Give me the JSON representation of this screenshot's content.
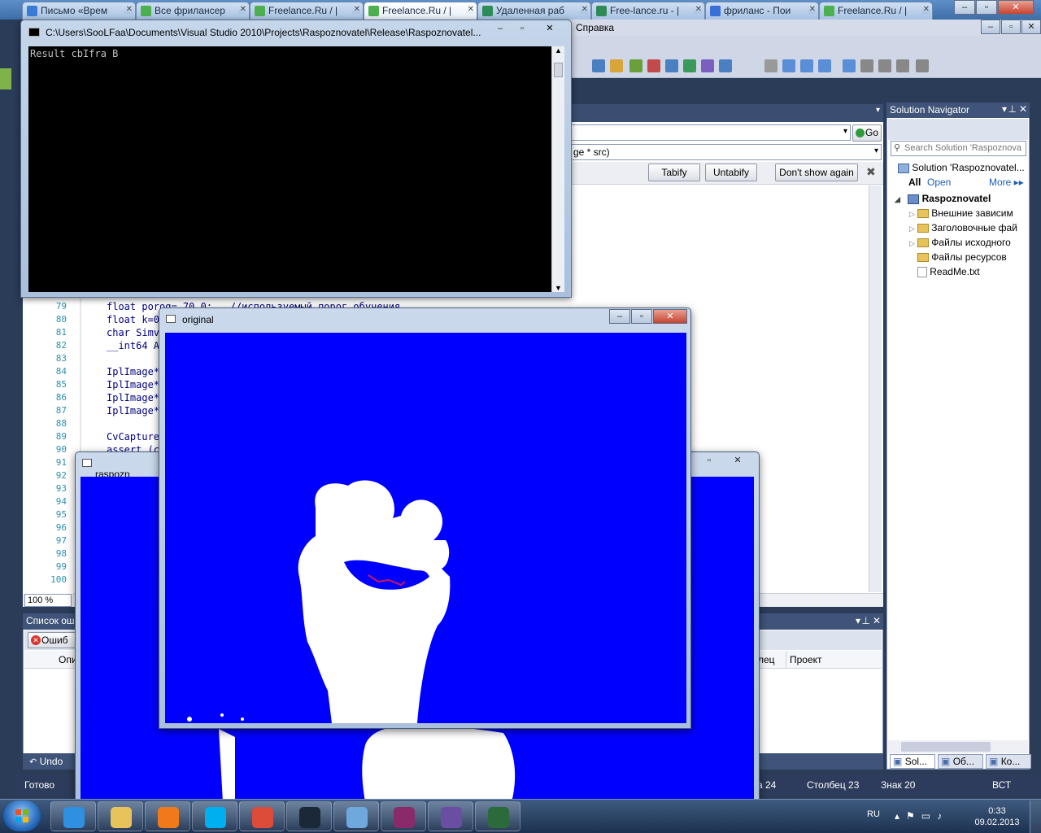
{
  "browser": {
    "tabs": [
      {
        "label": "Письмо «Врем",
        "color": "#3a7bd5"
      },
      {
        "label": "Все фрилансер",
        "color": "#4caf50"
      },
      {
        "label": "Freelance.Ru / |",
        "color": "#4caf50"
      },
      {
        "label": "Freelance.Ru / |",
        "color": "#4caf50",
        "active": true
      },
      {
        "label": "Удаленная раб",
        "color": "#2e8b57"
      },
      {
        "label": "Free-lance.ru - |",
        "color": "#2e8b57"
      },
      {
        "label": "фриланс - Пои",
        "color": "#3b6fd8"
      },
      {
        "label": "Freelance.Ru / |",
        "color": "#4caf50"
      }
    ]
  },
  "vs": {
    "menu_help": "Справка",
    "go_button": "Go",
    "function_combo": "ge * src)",
    "tabify": "Tabify",
    "untabify": "Untabify",
    "dont_show": "Don't show again",
    "zoom": "100 %",
    "line_numbers": [
      "79",
      "80",
      "81",
      "82",
      "83",
      "84",
      "85",
      "86",
      "87",
      "88",
      "89",
      "90",
      "91",
      "92",
      "93",
      "94",
      "95",
      "96",
      "97",
      "98",
      "99",
      "100"
    ],
    "code_lines": [
      "float porog= 70.0;   //используемый порог обучения",
      "float k=0",
      "char Simv",
      "__int64 A",
      "",
      "IplImage*",
      "IplImage*",
      "IplImage*",
      "IplImage*",
      "",
      "CvCapture",
      "assert (c"
    ],
    "error_list": {
      "title": "Список ош",
      "errors_tab": "Ошиб",
      "col_description": "Опи",
      "col_column": "лец",
      "col_project": "Проект",
      "undo": "Undo"
    },
    "solution_navigator": {
      "title": "Solution Navigator",
      "search_placeholder": "Search Solution 'Raspoznova",
      "solution": "Solution 'Raspoznovatel...",
      "filter_all": "All",
      "filter_open": "Open",
      "filter_more": "More",
      "project": "Raspoznovatel",
      "items": [
        "Внешние зависим",
        "Заголовочные фай",
        "Файлы исходного",
        "Файлы ресурсов",
        "ReadMe.txt"
      ],
      "bottom_tabs": [
        "Sol...",
        "Об...",
        "Ко..."
      ]
    },
    "status": {
      "ready": "Готово",
      "line": "а 24",
      "column": "Столбец 23",
      "char": "Знак 20",
      "mode": "ВСТ"
    }
  },
  "console": {
    "title": "C:\\Users\\SooLFaa\\Documents\\Visual Studio 2010\\Projects\\Raspoznovatel\\Release\\Raspoznovatel...",
    "output": "Result cbIfra B"
  },
  "original_window": {
    "title": "original"
  },
  "raspozn_window": {
    "title": "raspozn"
  },
  "taskbar": {
    "lang": "RU",
    "time": "0:33",
    "date": "09.02.2013",
    "apps": [
      {
        "name": "internet-explorer-icon",
        "color": "#2f8fe0"
      },
      {
        "name": "file-explorer-icon",
        "color": "#e8c35a"
      },
      {
        "name": "media-player-icon",
        "color": "#f07a1a"
      },
      {
        "name": "skype-icon",
        "color": "#00aff0"
      },
      {
        "name": "chrome-icon",
        "color": "#dd4b39"
      },
      {
        "name": "steam-icon",
        "color": "#1b2838"
      },
      {
        "name": "notepad-icon",
        "color": "#6fa8dc"
      },
      {
        "name": "winrar-icon",
        "color": "#8b2a6b"
      },
      {
        "name": "visual-studio-icon",
        "color": "#6a4ea1"
      },
      {
        "name": "console-app-icon",
        "color": "#2b6a3a"
      }
    ]
  }
}
